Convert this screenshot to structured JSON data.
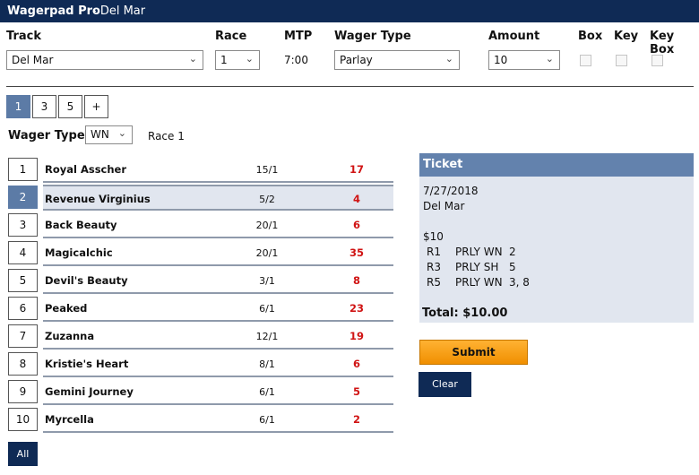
{
  "app": {
    "title": "Wagerpad Pro",
    "subtitle": "- Del Mar"
  },
  "headers": {
    "track": "Track",
    "race": "Race",
    "mtp": "MTP",
    "wager_type": "Wager Type",
    "amount": "Amount",
    "box": "Box",
    "key": "Key",
    "key_box": "Key Box"
  },
  "controls": {
    "track": "Del Mar",
    "race": "1",
    "mtp": "7:00",
    "wager_type": "Parlay",
    "amount": "10",
    "box_checked": false,
    "key_checked": false,
    "key_box_checked": false
  },
  "race_tabs": [
    {
      "label": "1",
      "active": true
    },
    {
      "label": "3",
      "active": false
    },
    {
      "label": "5",
      "active": false
    },
    {
      "label": "+",
      "active": false
    }
  ],
  "wager": {
    "label": "Wager Type",
    "selected": "WN",
    "race_label": "Race 1"
  },
  "runners": [
    {
      "num": "1",
      "name": "Royal Asscher",
      "odds": "15/1",
      "pool": "17",
      "selected": false
    },
    {
      "num": "2",
      "name": "Revenue Virginius",
      "odds": "5/2",
      "pool": "4",
      "selected": true
    },
    {
      "num": "3",
      "name": "Back Beauty",
      "odds": "20/1",
      "pool": "6",
      "selected": false
    },
    {
      "num": "4",
      "name": "Magicalchic",
      "odds": "20/1",
      "pool": "35",
      "selected": false
    },
    {
      "num": "5",
      "name": "Devil's Beauty",
      "odds": "3/1",
      "pool": "8",
      "selected": false
    },
    {
      "num": "6",
      "name": "Peaked",
      "odds": "6/1",
      "pool": "23",
      "selected": false
    },
    {
      "num": "7",
      "name": "Zuzanna",
      "odds": "12/1",
      "pool": "19",
      "selected": false
    },
    {
      "num": "8",
      "name": "Kristie's Heart",
      "odds": "8/1",
      "pool": "6",
      "selected": false
    },
    {
      "num": "9",
      "name": "Gemini Journey",
      "odds": "6/1",
      "pool": "5",
      "selected": false
    },
    {
      "num": "10",
      "name": "Myrcella",
      "odds": "6/1",
      "pool": "2",
      "selected": false
    }
  ],
  "all_label": "All",
  "ticket": {
    "title": "Ticket",
    "date": "7/27/2018",
    "track": "Del Mar",
    "amount": "$10",
    "legs": [
      {
        "race": "R1",
        "type": "PRLY WN",
        "picks": "2"
      },
      {
        "race": "R3",
        "type": "PRLY SH",
        "picks": "5"
      },
      {
        "race": "R5",
        "type": "PRLY WN",
        "picks": "3, 8"
      }
    ],
    "total": "Total: $10.00"
  },
  "buttons": {
    "submit": "Submit",
    "clear": "Clear"
  },
  "colors": {
    "titlebar": "#0f2a55",
    "accent": "#5c7ba6",
    "ticket_header": "#6382ad",
    "ticket_bg": "#e1e6ef",
    "pool_text": "#d01414",
    "submit": "#f5a21b"
  }
}
